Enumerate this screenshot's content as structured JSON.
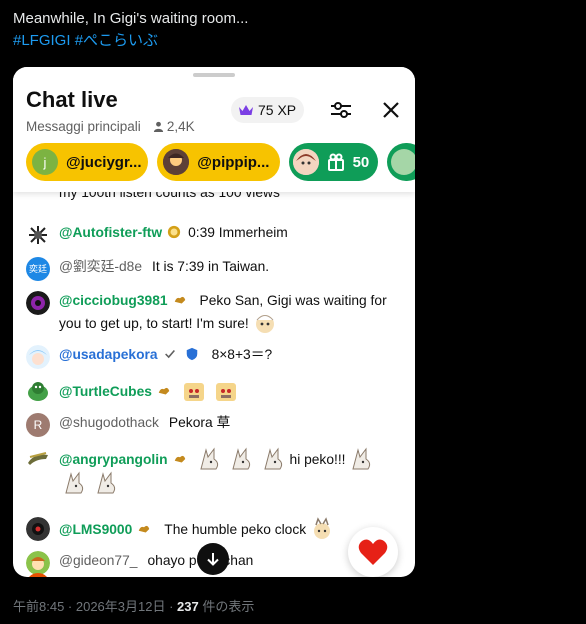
{
  "tweet": {
    "line1": "Meanwhile, In Gigi's waiting room...",
    "hashtag1": "#LFGIGI",
    "hashtag2": "#ぺこらいぶ"
  },
  "chat": {
    "title": "Chat live",
    "subtitle": "Messaggi principali",
    "viewers": "2,4K",
    "xp": "75 XP",
    "chips": [
      {
        "avatar_letter": "j",
        "name": "@juciygr..."
      },
      {
        "name": "@pippip..."
      },
      {
        "count": "50"
      }
    ],
    "messages": [
      {
        "text": "my 100th listen counts as 100 views"
      },
      {
        "author": "@Autofister-ftw",
        "text": "0:39 Immerheim"
      },
      {
        "avatar_text": "奕廷",
        "author": "@劉奕廷-d8e",
        "text": "It is 7:39 in Taiwan."
      },
      {
        "author": "@cicciobug3981",
        "text": "Peko San, Gigi was waiting for you to get up, to start! I'm sure!"
      },
      {
        "author": "@usadapekora",
        "text": "8×8+3＝?"
      },
      {
        "author": "@TurtleCubes"
      },
      {
        "avatar_text": "R",
        "author": "@shugodothack",
        "text": "Pekora 草"
      },
      {
        "author": "@angrypangolin",
        "text": "hi peko!!!"
      },
      {
        "author": "@LMS9000",
        "text": "The humble peko clock"
      },
      {
        "author": "@gideon77_",
        "text": "ohayo peko-chan"
      }
    ]
  },
  "footer": {
    "time": "午前8:45 · 2026年3月12日 · ",
    "views": "237",
    "views_label": " 件の表示"
  },
  "colors": {
    "accent_gold": "#f7c300",
    "member_green": "#0f9d58",
    "hashtag_blue": "#1d9bf0",
    "heart_red": "#e62117"
  }
}
